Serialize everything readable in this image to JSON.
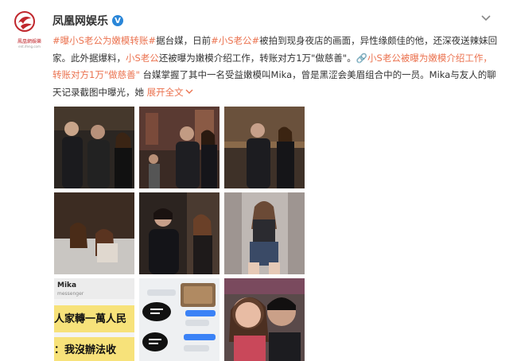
{
  "account": {
    "name": "凤凰网娱乐",
    "verified_mark": "V",
    "logo_brand": "鳳凰網娛樂",
    "logo_site": "ent.ifeng.com"
  },
  "post": {
    "segments": [
      {
        "text": "#曝小S老公为嫩模转账#",
        "style": "tag"
      },
      {
        "text": "据台媒，日前",
        "style": "plain"
      },
      {
        "text": "#小S老公#",
        "style": "tag"
      },
      {
        "text": "被拍到现身夜店的画面，异性缘颇佳的他，还深夜送辣妹回家。此外据爆料，",
        "style": "plain"
      },
      {
        "text": "小S老公",
        "style": "mention"
      },
      {
        "text": "还被曝为嫩模介绍工作，转账对方1万\"做慈善\"。",
        "style": "plain"
      },
      {
        "text": "🔗小S老公被曝为嫩模介绍工作，转账对方1万\"做慈善\"",
        "style": "link"
      },
      {
        "text": " 台媒掌握了其中一名受益嫩模叫Mika，曾是黑涩会美眉组合中的一员。Mika与友人的聊天记录截图中曝光，她 ",
        "style": "plain"
      },
      {
        "text": "展开全文",
        "style": "expand"
      }
    ],
    "expand_icon": "chevron-down-icon",
    "menu_icon": "chevron-down-icon"
  },
  "photos": {
    "chat_name": "Mika",
    "chat_sub": "messenger",
    "chat_line1": "人家轉一萬人民",
    "chat_line2": "：我沒辦法收"
  },
  "colors": {
    "tag": "#eb7350",
    "verified": "#2a86d8",
    "logo_red": "#c0272d"
  }
}
